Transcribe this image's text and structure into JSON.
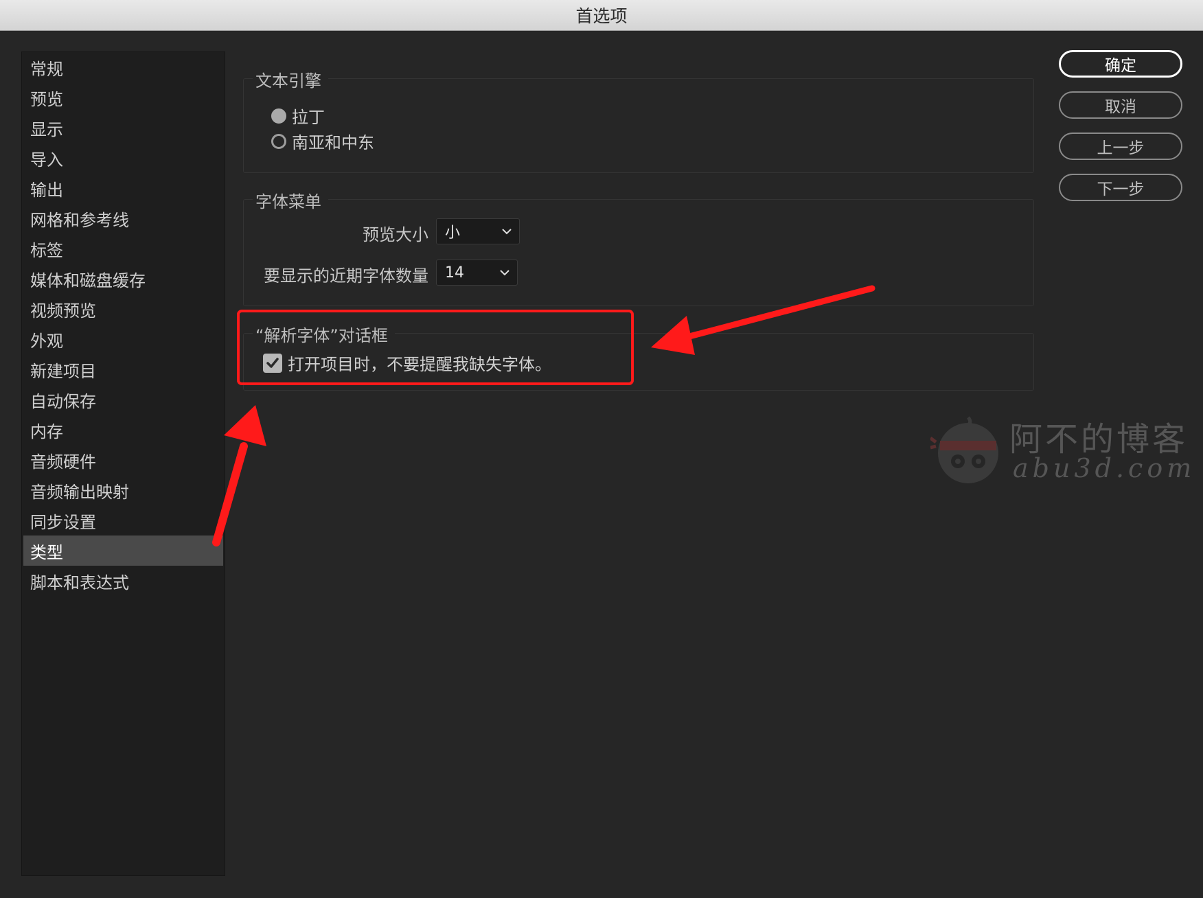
{
  "window": {
    "title": "首选项"
  },
  "sidebar": {
    "items": [
      {
        "label": "常规"
      },
      {
        "label": "预览"
      },
      {
        "label": "显示"
      },
      {
        "label": "导入"
      },
      {
        "label": "输出"
      },
      {
        "label": "网格和参考线"
      },
      {
        "label": "标签"
      },
      {
        "label": "媒体和磁盘缓存"
      },
      {
        "label": "视频预览"
      },
      {
        "label": "外观"
      },
      {
        "label": "新建项目"
      },
      {
        "label": "自动保存"
      },
      {
        "label": "内存"
      },
      {
        "label": "音频硬件"
      },
      {
        "label": "音频输出映射"
      },
      {
        "label": "同步设置"
      },
      {
        "label": "类型",
        "selected": true
      },
      {
        "label": "脚本和表达式"
      }
    ]
  },
  "text_engine": {
    "title": "文本引擎",
    "options": [
      {
        "label": "拉丁",
        "selected": true
      },
      {
        "label": "南亚和中东",
        "selected": false
      }
    ]
  },
  "font_menu": {
    "title": "字体菜单",
    "preview_size_label": "预览大小",
    "preview_size_value": "小",
    "recent_fonts_label": "要显示的近期字体数量",
    "recent_fonts_value": "14"
  },
  "resolve_fonts": {
    "title": "“解析字体”对话框",
    "checkbox_label": "打开项目时，不要提醒我缺失字体。",
    "checked": true
  },
  "buttons": {
    "ok": "确定",
    "cancel": "取消",
    "previous": "上一步",
    "next": "下一步"
  },
  "watermark": {
    "title": "阿不的博客",
    "subtitle": "abu3d.com"
  },
  "colors": {
    "annotation": "#ff1a1a",
    "background": "#262626",
    "sidebar": "#1e1e1e",
    "selected": "#4a4a4a"
  }
}
